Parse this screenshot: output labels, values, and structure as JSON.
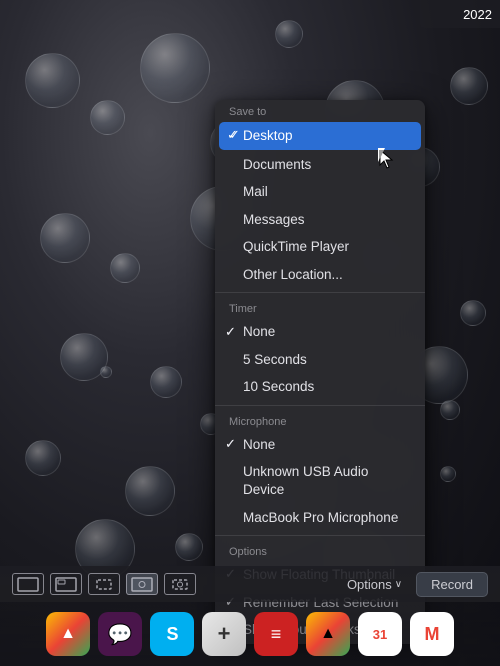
{
  "menubar": {
    "year_text": "2022"
  },
  "dropdown": {
    "save_to_section": {
      "header": "Save to",
      "items": [
        {
          "label": "Desktop",
          "checked": true,
          "selected": true
        },
        {
          "label": "Documents",
          "checked": false,
          "selected": false
        },
        {
          "label": "Mail",
          "checked": false,
          "selected": false
        },
        {
          "label": "Messages",
          "checked": false,
          "selected": false
        },
        {
          "label": "QuickTime Player",
          "checked": false,
          "selected": false
        },
        {
          "label": "Other Location...",
          "checked": false,
          "selected": false
        }
      ]
    },
    "timer_section": {
      "header": "Timer",
      "items": [
        {
          "label": "None",
          "checked": true,
          "selected": false
        },
        {
          "label": "5 Seconds",
          "checked": false,
          "selected": false
        },
        {
          "label": "10 Seconds",
          "checked": false,
          "selected": false
        }
      ]
    },
    "microphone_section": {
      "header": "Microphone",
      "items": [
        {
          "label": "None",
          "checked": true,
          "selected": false
        },
        {
          "label": "Unknown USB Audio Device",
          "checked": false,
          "selected": false
        },
        {
          "label": "MacBook Pro Microphone",
          "checked": false,
          "selected": false
        }
      ]
    },
    "options_section": {
      "header": "Options",
      "items": [
        {
          "label": "Show Floating Thumbnail",
          "checked": true,
          "selected": false
        },
        {
          "label": "Remember Last Selection",
          "checked": true,
          "selected": false
        },
        {
          "label": "Show Mouse Clicks",
          "checked": false,
          "selected": false
        }
      ]
    }
  },
  "toolbar": {
    "options_label": "Options",
    "record_label": "Record",
    "chevron": "∨"
  },
  "dock": {
    "icons": [
      {
        "name": "google-drive-icon",
        "emoji": "🔺",
        "bg": "#4285f4"
      },
      {
        "name": "slack-icon",
        "emoji": "💬",
        "bg": "#611f69"
      },
      {
        "name": "skype-icon",
        "emoji": "S",
        "bg": "#00aff0"
      },
      {
        "name": "crossover-icon",
        "emoji": "+",
        "bg": "#e8e8e8"
      },
      {
        "name": "app-icon",
        "emoji": "≡",
        "bg": "#cc2222"
      },
      {
        "name": "google-drive2-icon",
        "emoji": "▲",
        "bg": "#34a853"
      },
      {
        "name": "calendar-icon",
        "emoji": "31",
        "bg": "#4285f4"
      },
      {
        "name": "gmail-icon",
        "emoji": "M",
        "bg": "#ea4335"
      }
    ]
  }
}
